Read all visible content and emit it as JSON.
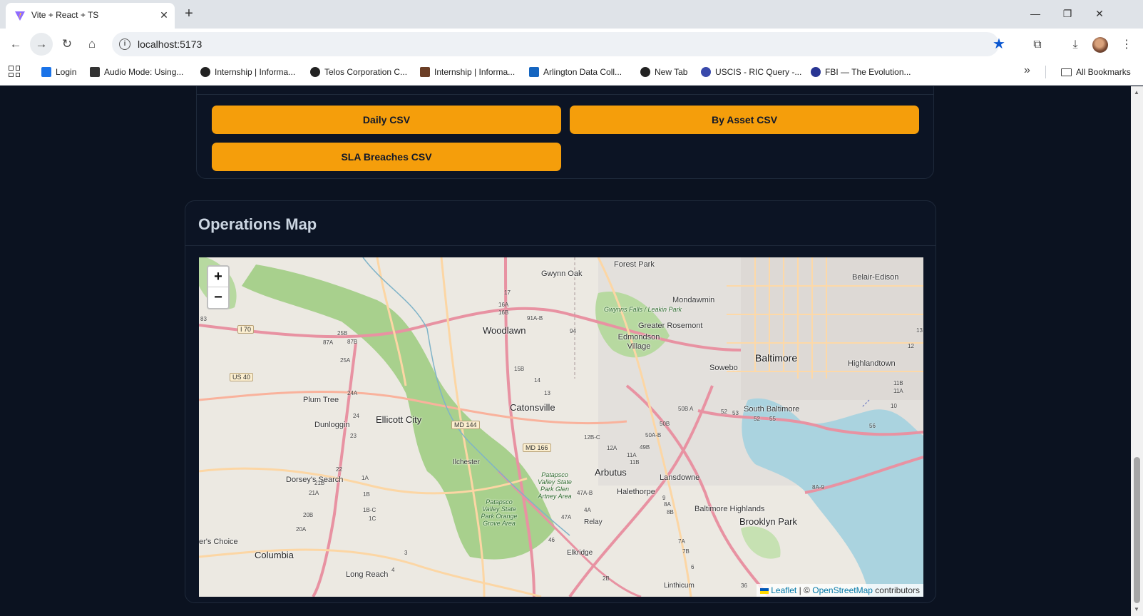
{
  "browser": {
    "tab_title": "Vite + React + TS",
    "url": "localhost:5173",
    "bookmarks": [
      {
        "label": "Login",
        "color": "#1a73e8"
      },
      {
        "label": "Audio Mode: Using...",
        "color": "#333333"
      },
      {
        "label": "Internship | Informa...",
        "color": "#222222"
      },
      {
        "label": "Telos Corporation C...",
        "color": "#222222"
      },
      {
        "label": "Internship | Informa...",
        "color": "#6b3e26"
      },
      {
        "label": "Arlington Data Coll...",
        "color": "#1565c0"
      },
      {
        "label": "New Tab",
        "color": "#222222"
      },
      {
        "label": "USCIS - RIC Query -...",
        "color": "#3949ab"
      },
      {
        "label": "FBI — The Evolution...",
        "color": "#283593"
      }
    ],
    "all_bookmarks": "All Bookmarks"
  },
  "exports": {
    "daily_csv": "Daily CSV",
    "by_asset_csv": "By Asset CSV",
    "sla_breaches_csv": "SLA Breaches CSV"
  },
  "map_section": {
    "title": "Operations Map",
    "zoom_in": "+",
    "zoom_out": "−",
    "attribution": {
      "leaflet": "Leaflet",
      "separator": "| ©",
      "osm": "OpenStreetMap",
      "contributors": "contributors"
    },
    "places": {
      "forest_park": "Forest Park",
      "gwynn_oak": "Gwynn Oak",
      "belair_edison": "Belair-Edison",
      "mondawmin": "Mondawmin",
      "gwynns_falls": "Gwynns Falls / Leakin Park",
      "greater_rosemont": "Greater Rosemont",
      "woodlawn": "Woodlawn",
      "edmondson_village": "Edmondson Village",
      "baltimore": "Baltimore",
      "highlandtown": "Highlandtown",
      "sowebo": "Sowebo",
      "catonsville": "Catonsville",
      "south_baltimore": "South Baltimore",
      "plum_tree": "Plum Tree",
      "ellicott_city": "Ellicott City",
      "dunloggin": "Dunloggin",
      "ilchester": "Ilchester",
      "arbutus": "Arbutus",
      "lansdowne": "Lansdowne",
      "dorseys_search": "Dorsey's Search",
      "halethorpe": "Halethorpe",
      "patapsco_glen": "Patapsco Valley State Park Glen Artney Area",
      "patapsco_orange": "Patapsco Valley State Park Orange Grove Area",
      "baltimore_highlands": "Baltimore Highlands",
      "brooklyn_park": "Brooklyn Park",
      "relay": "Relay",
      "ers_choice": "er's Choice",
      "columbia": "Columbia",
      "elkridge": "Elkridge",
      "long_reach": "Long Reach",
      "linthicum": "Linthicum"
    },
    "shields": {
      "i70": "I 70",
      "us40": "US 40",
      "md144": "MD 144",
      "md166": "MD 166"
    },
    "exits": [
      "83",
      "25B",
      "87B",
      "87A",
      "25A",
      "24A",
      "24",
      "23",
      "22",
      "21B",
      "21A",
      "20B",
      "20A",
      "1A",
      "1B",
      "1B-C",
      "1C",
      "4",
      "3",
      "17",
      "16A",
      "16B",
      "91A-B",
      "94",
      "15B",
      "14",
      "13",
      "12B-C",
      "12A",
      "11A",
      "11B",
      "49B",
      "50A-B",
      "50B",
      "50B A",
      "52",
      "53",
      "52",
      "55",
      "56",
      "10",
      "11B",
      "11A",
      "12",
      "13",
      "9",
      "8A",
      "8B",
      "7A",
      "7B",
      "6",
      "47A-B",
      "4A",
      "47A",
      "46",
      "2B",
      "8A-9",
      "36"
    ],
    "colors": {
      "land": "#f2efe9",
      "park": "#a8d08d",
      "water": "#aad3df",
      "motorway": "#e892a2",
      "trunk": "#f9b29c",
      "primary": "#fcd6a4",
      "urban": "#e0dfdf"
    }
  }
}
